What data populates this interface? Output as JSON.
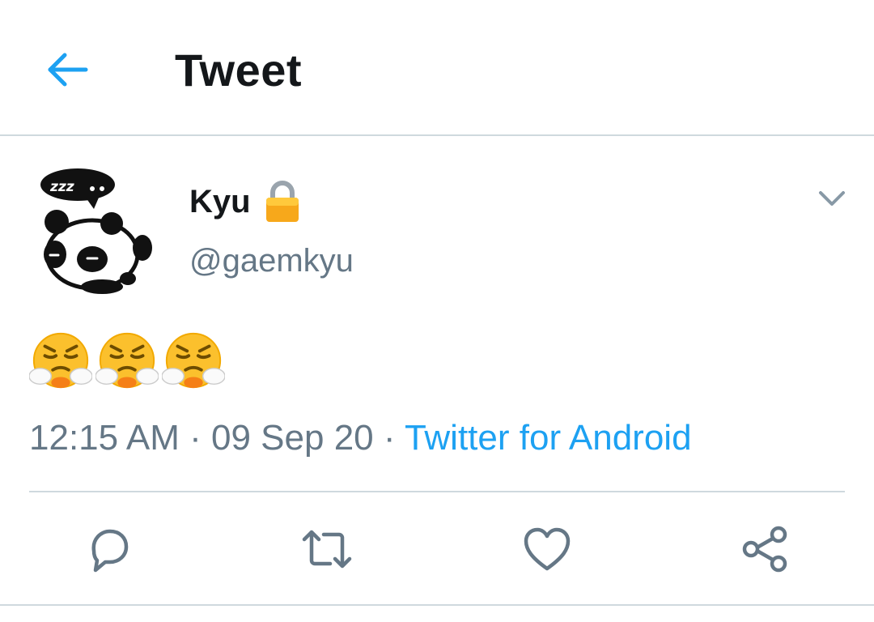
{
  "header": {
    "title": "Tweet",
    "back_icon": "arrow-left-icon"
  },
  "tweet": {
    "author": {
      "display_name": "Kyu",
      "handle": "@gaemkyu",
      "protected": true,
      "avatar": "sleeping-panda-avatar"
    },
    "text_emoji": [
      "face-with-steam-from-nose",
      "face-with-steam-from-nose",
      "face-with-steam-from-nose"
    ],
    "time": "12:15 AM",
    "separator": " · ",
    "date": "09 Sep 20",
    "source": "Twitter for Android"
  },
  "actions": [
    {
      "name": "reply",
      "icon": "reply-icon"
    },
    {
      "name": "retweet",
      "icon": "retweet-icon"
    },
    {
      "name": "like",
      "icon": "heart-icon"
    },
    {
      "name": "share",
      "icon": "share-icon"
    }
  ],
  "colors": {
    "accent": "#1da1f2",
    "text_primary": "#14171a",
    "text_secondary": "#657786",
    "divider": "#cfd9de",
    "icon": "#657786"
  }
}
